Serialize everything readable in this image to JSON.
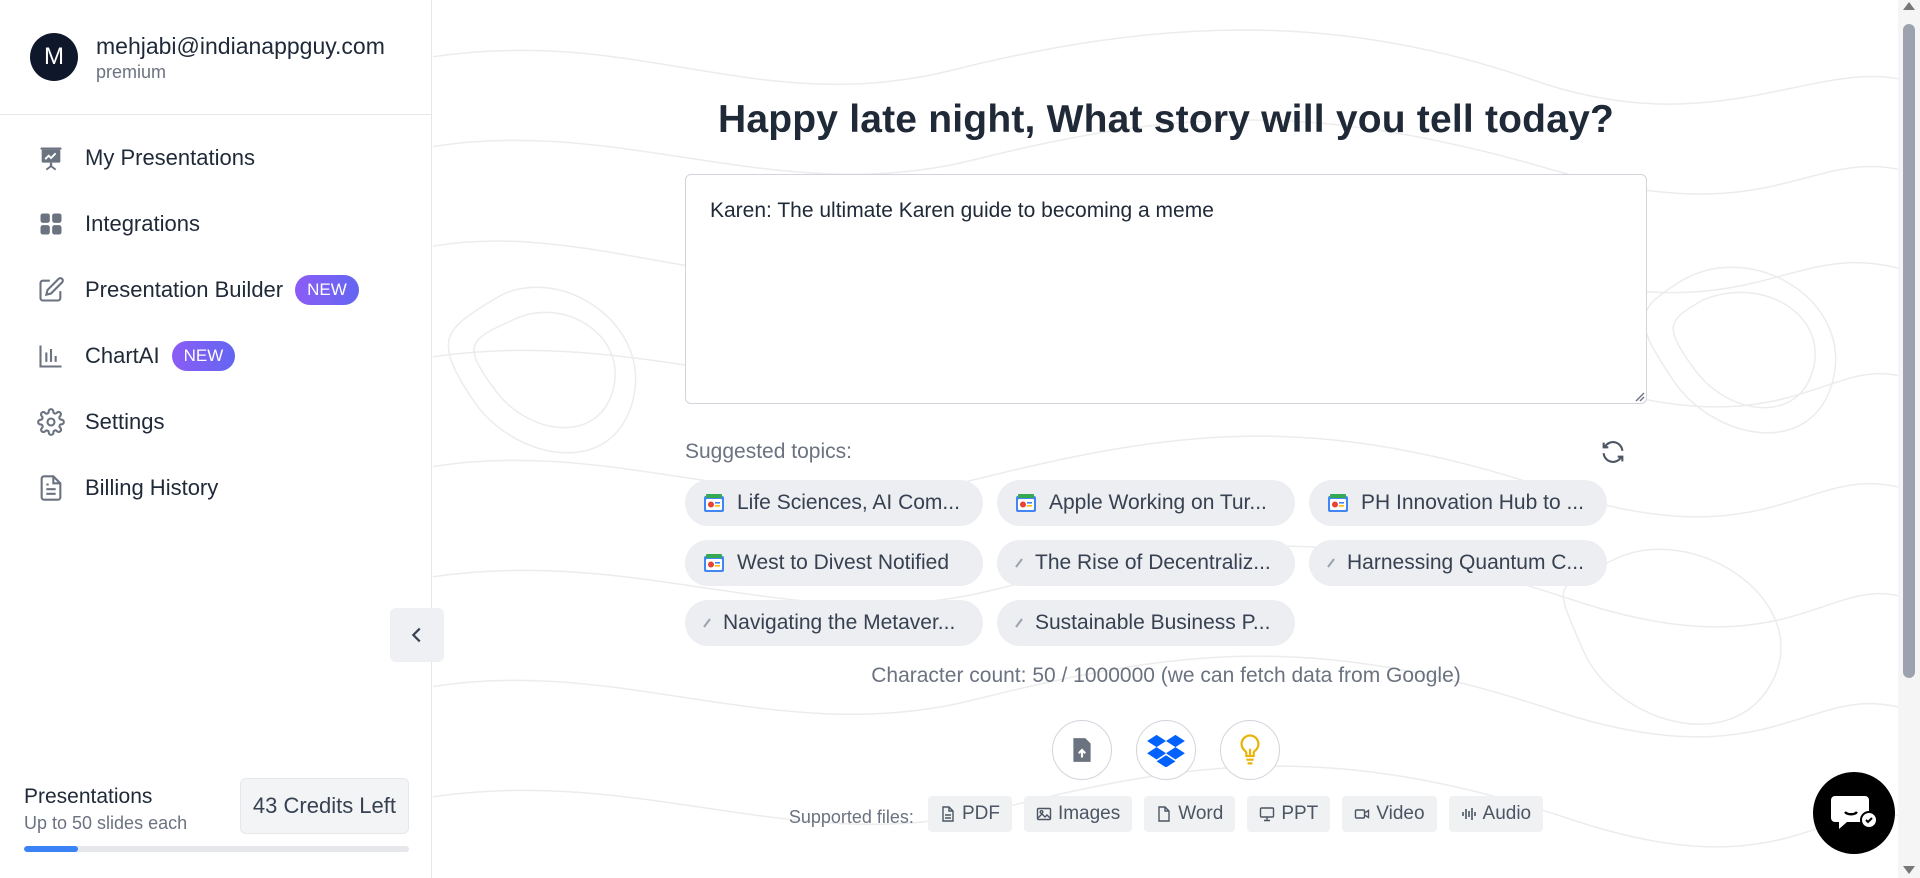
{
  "user": {
    "avatar_initial": "M",
    "email": "mehjabi@indianappguy.com",
    "plan": "premium"
  },
  "sidebar": {
    "items": [
      {
        "label": "My Presentations",
        "icon": "presentation-icon"
      },
      {
        "label": "Integrations",
        "icon": "grid-icon"
      },
      {
        "label": "Presentation Builder",
        "icon": "edit-icon",
        "badge": "NEW"
      },
      {
        "label": "ChartAI",
        "icon": "bar-chart-icon",
        "badge": "NEW"
      },
      {
        "label": "Settings",
        "icon": "gear-icon"
      },
      {
        "label": "Billing History",
        "icon": "document-icon"
      }
    ],
    "collapse_icon": "chevron-left-icon"
  },
  "footer": {
    "title": "Presentations",
    "subtitle": "Up to 50 slides each",
    "credits": "43 Credits Left",
    "progress_fraction": 0.14
  },
  "main": {
    "headline": "Happy late night, What story will you tell today?",
    "topic_value": "Karen: The ultimate Karen guide to becoming a meme",
    "suggested_label": "Suggested topics:",
    "suggestions": [
      {
        "label": "Life Sciences, AI Com...",
        "icon": "google-news-icon"
      },
      {
        "label": "Apple Working on Tur...",
        "icon": "google-news-icon"
      },
      {
        "label": "PH Innovation Hub to ...",
        "icon": "google-news-icon"
      },
      {
        "label": "West to Divest Notified",
        "icon": "google-news-icon"
      },
      {
        "label": "The Rise of Decentraliz...",
        "icon": "pen-icon"
      },
      {
        "label": "Harnessing Quantum C...",
        "icon": "pen-icon"
      },
      {
        "label": "Navigating the Metaver...",
        "icon": "pen-icon"
      },
      {
        "label": "Sustainable Business P...",
        "icon": "pen-icon"
      }
    ],
    "char_count": "Character count: 50 / 1000000 (we can fetch data from Google)",
    "upload_buttons": [
      "upload-icon",
      "dropbox-icon",
      "lightbulb-icon"
    ],
    "supported_label": "Supported files:",
    "file_types": [
      "PDF",
      "Images",
      "Word",
      "PPT",
      "Video",
      "Audio"
    ]
  },
  "colors": {
    "accent": "#3b82f6",
    "badge": "#7c5cf0",
    "avatar": "#0f172a",
    "dropbox": "#0061fe",
    "bulb": "#eab308"
  }
}
